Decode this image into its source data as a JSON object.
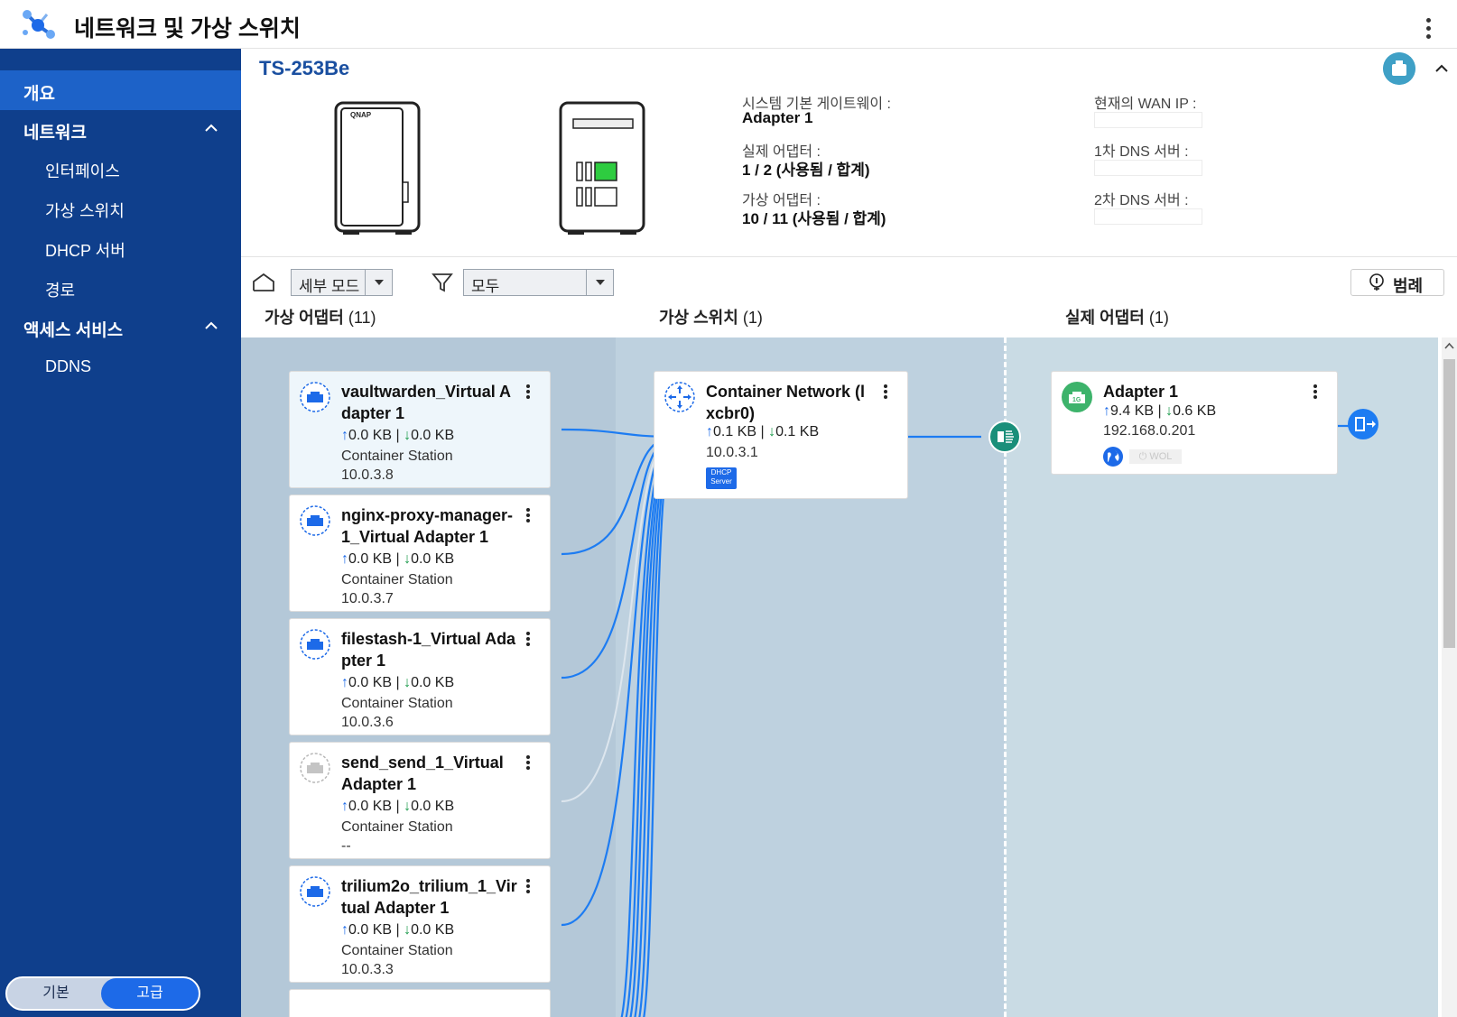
{
  "app": {
    "title": "네트워크 및 가상 스위치"
  },
  "sidebar": {
    "items": [
      {
        "label": "개요"
      },
      {
        "label": "네트워크"
      },
      {
        "label": "인터페이스"
      },
      {
        "label": "가상 스위치"
      },
      {
        "label": "DHCP 서버"
      },
      {
        "label": "경로"
      },
      {
        "label": "액세스 서비스"
      },
      {
        "label": "DDNS"
      }
    ],
    "mode": {
      "basic": "기본",
      "advanced": "고급",
      "selected": "고급"
    }
  },
  "device": {
    "name": "TS-253Be",
    "gateway_label": "시스템 기본 게이트웨이 :",
    "gateway_value": "Adapter 1",
    "physical_label": "실제 어댑터 :",
    "physical_value": "1 / 2 (사용됨 / 합계)",
    "virtual_label": "가상 어댑터 :",
    "virtual_value": "10 / 11 (사용됨 / 합계)",
    "wan_ip_label": "현재의 WAN IP :",
    "dns1_label": "1차 DNS 서버 :",
    "dns2_label": "2차 DNS 서버 :"
  },
  "toolbar": {
    "view_mode": "세부 모드",
    "filter": "모두",
    "legend": "범례"
  },
  "columns": {
    "virtual_adapters": {
      "label": "가상 어댑터",
      "count": "(11)"
    },
    "virtual_switches": {
      "label": "가상 스위치",
      "count": "(1)"
    },
    "physical_adapters": {
      "label": "실제 어댑터",
      "count": "(1)"
    }
  },
  "virtual_adapters": [
    {
      "name": "vaultwarden_Virtual Adapter 1",
      "up": "0.0 KB",
      "down": "0.0 KB",
      "source": "Container Station",
      "ip": "10.0.3.8",
      "active": true
    },
    {
      "name": "nginx-proxy-manager-1_Virtual Adapter 1",
      "up": "0.0 KB",
      "down": "0.0 KB",
      "source": "Container Station",
      "ip": "10.0.3.7",
      "active": true
    },
    {
      "name": "filestash-1_Virtual Adapter 1",
      "up": "0.0 KB",
      "down": "0.0 KB",
      "source": "Container Station",
      "ip": "10.0.3.6",
      "active": true
    },
    {
      "name": "send_send_1_Virtual Adapter 1",
      "up": "0.0 KB",
      "down": "0.0 KB",
      "source": "Container Station",
      "ip": "--",
      "active": false
    },
    {
      "name": "trilium2o_trilium_1_Virtual Adapter 1",
      "up": "0.0 KB",
      "down": "0.0 KB",
      "source": "Container Station",
      "ip": "10.0.3.3",
      "active": true
    }
  ],
  "virtual_switch": {
    "name": "Container Network (lxcbr0)",
    "up": "0.1 KB",
    "down": "0.1 KB",
    "ip": "10.0.3.1",
    "dhcp_badge": [
      "DHCP",
      "Server"
    ]
  },
  "physical_adapter": {
    "name": "Adapter 1",
    "speed": "1G",
    "up": "9.4 KB",
    "down": "0.6 KB",
    "ip": "192.168.0.201",
    "wol": "WOL"
  },
  "colors": {
    "sidebar": "#0f3f8c",
    "active": "#1d62c8",
    "accent": "#1d6ae8",
    "green": "#1a9a4a"
  }
}
